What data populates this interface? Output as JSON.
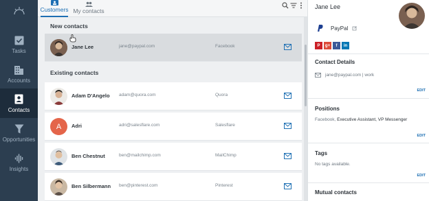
{
  "tabs": [
    {
      "label": "Customers",
      "active": true
    },
    {
      "label": "My contacts",
      "active": false
    }
  ],
  "sidebar": {
    "items": [
      {
        "label": "Tasks",
        "icon": "check-icon"
      },
      {
        "label": "Accounts",
        "icon": "building-icon"
      },
      {
        "label": "Contacts",
        "icon": "contact-card-icon",
        "active": true
      },
      {
        "label": "Opportunities",
        "icon": "funnel-icon"
      },
      {
        "label": "Insights",
        "icon": "soundwave-icon"
      }
    ]
  },
  "list": {
    "new_title": "New contacts",
    "existing_title": "Existing contacts",
    "new_contacts": [
      {
        "name": "Jane Lee",
        "email": "jane@paypal.com",
        "company": "Facebook"
      }
    ],
    "existing_contacts": [
      {
        "name": "Adam D'Angelo",
        "email": "adam@quora.com",
        "company": "Quora"
      },
      {
        "name": "Adri",
        "email": "adri@salesflare.com",
        "company": "Salesflare",
        "initial": "A"
      },
      {
        "name": "Ben Chestnut",
        "email": "ben@mailchimp.com",
        "company": "MailChimp"
      },
      {
        "name": "Ben Silbermann",
        "email": "ben@pinterest.com",
        "company": "Pinterest"
      }
    ]
  },
  "panel": {
    "name": "Jane Lee",
    "company": "PayPal",
    "socials": [
      "P",
      "g+",
      "f",
      "in"
    ],
    "contact_details_title": "Contact Details",
    "email_line": "jane@paypal.com  | work",
    "positions_title": "Positions",
    "positions_company": "Facebook",
    "positions_roles": "Executive Assistant, VP Messenger",
    "tags_title": "Tags",
    "tags_empty": "No tags available.",
    "mutual_title": "Mutual contacts",
    "edit_label": "EDIT"
  },
  "colors": {
    "sidebar": "#2c3e50",
    "accent": "#1d6fb3",
    "paypal": "#1d3f91",
    "adri_avatar": "#e4654a"
  }
}
